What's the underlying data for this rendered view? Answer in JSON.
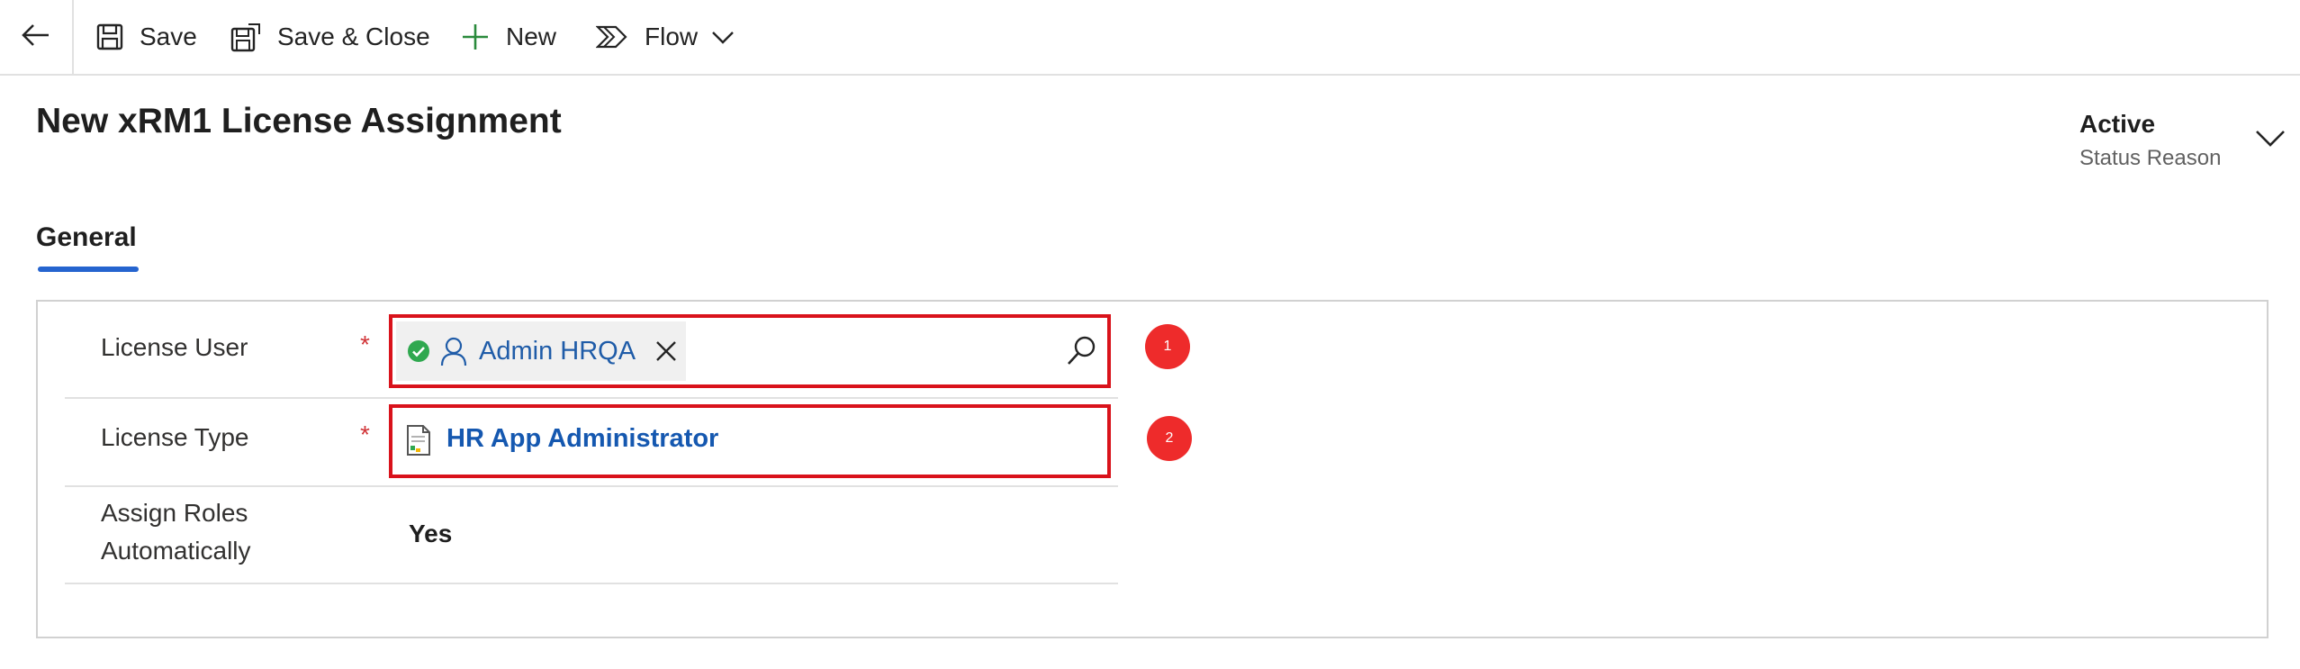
{
  "toolbar": {
    "save_label": "Save",
    "save_close_label": "Save & Close",
    "new_label": "New",
    "flow_label": "Flow"
  },
  "header": {
    "title": "New xRM1 License Assignment",
    "status_value": "Active",
    "status_label": "Status Reason"
  },
  "tabs": [
    {
      "label": "General",
      "selected": true
    }
  ],
  "form": {
    "license_user": {
      "label": "License User",
      "required_marker": "*",
      "value": "Admin HRQA"
    },
    "license_type": {
      "label": "License Type",
      "required_marker": "*",
      "value": "HR App Administrator"
    },
    "assign_roles": {
      "label": "Assign Roles Automatically",
      "value": "Yes"
    }
  },
  "annotations": [
    {
      "number": "1"
    },
    {
      "number": "2"
    }
  ],
  "colors": {
    "accent": "#2564cf",
    "link": "#1558b0",
    "highlight_border": "#d9121b",
    "badge": "#ee2b2b",
    "required": "#d13438"
  },
  "icons": {
    "back": "arrow-left-icon",
    "save": "floppy-disk-icon",
    "save_close": "save-close-icon",
    "new": "plus-icon",
    "flow": "flow-icon",
    "search": "search-icon",
    "remove": "close-icon",
    "user": "person-icon",
    "resolved": "check-circle-icon",
    "record": "document-icon"
  }
}
